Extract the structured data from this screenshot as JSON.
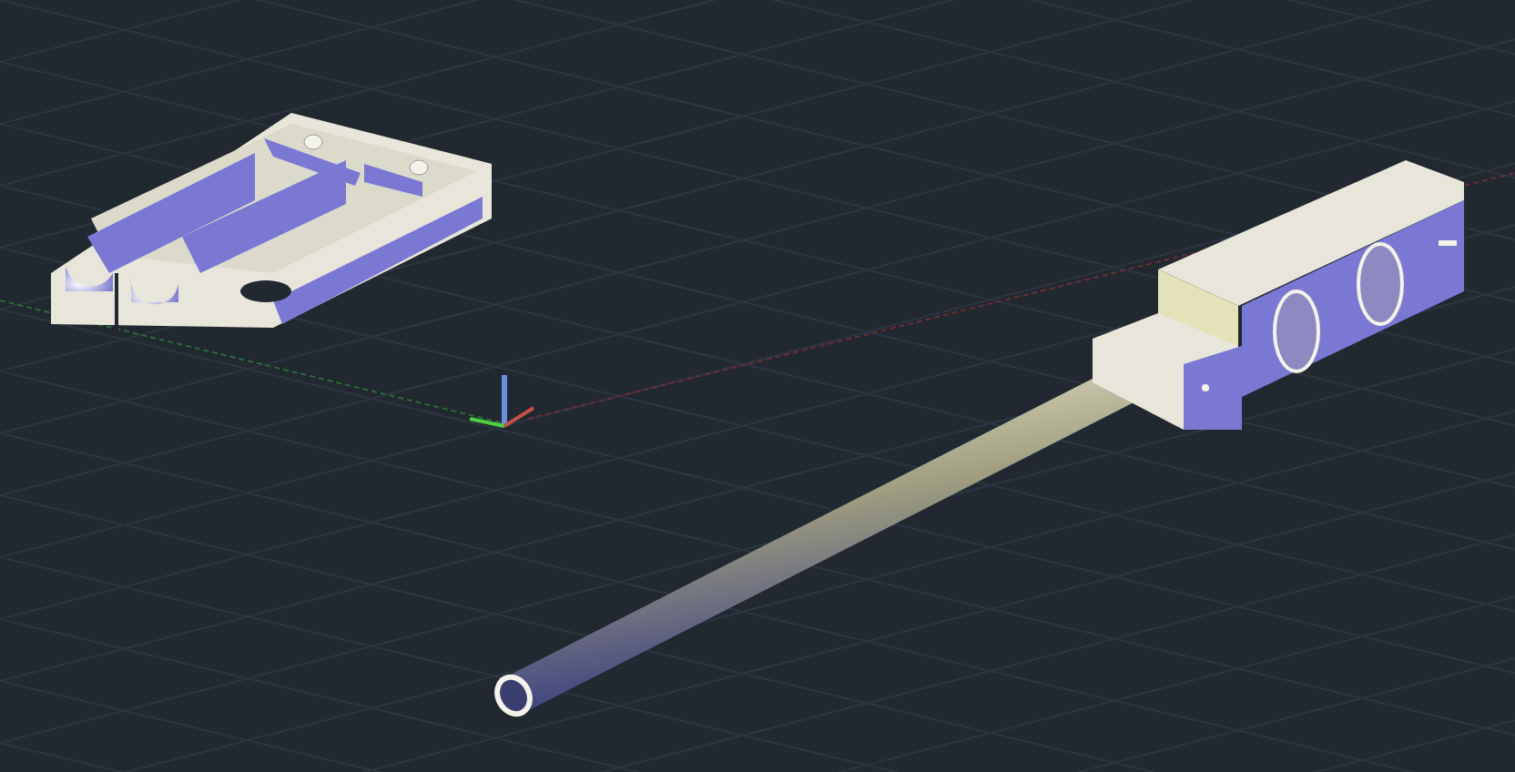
{
  "viewport": {
    "grid": true,
    "ucs_icon": true
  }
}
